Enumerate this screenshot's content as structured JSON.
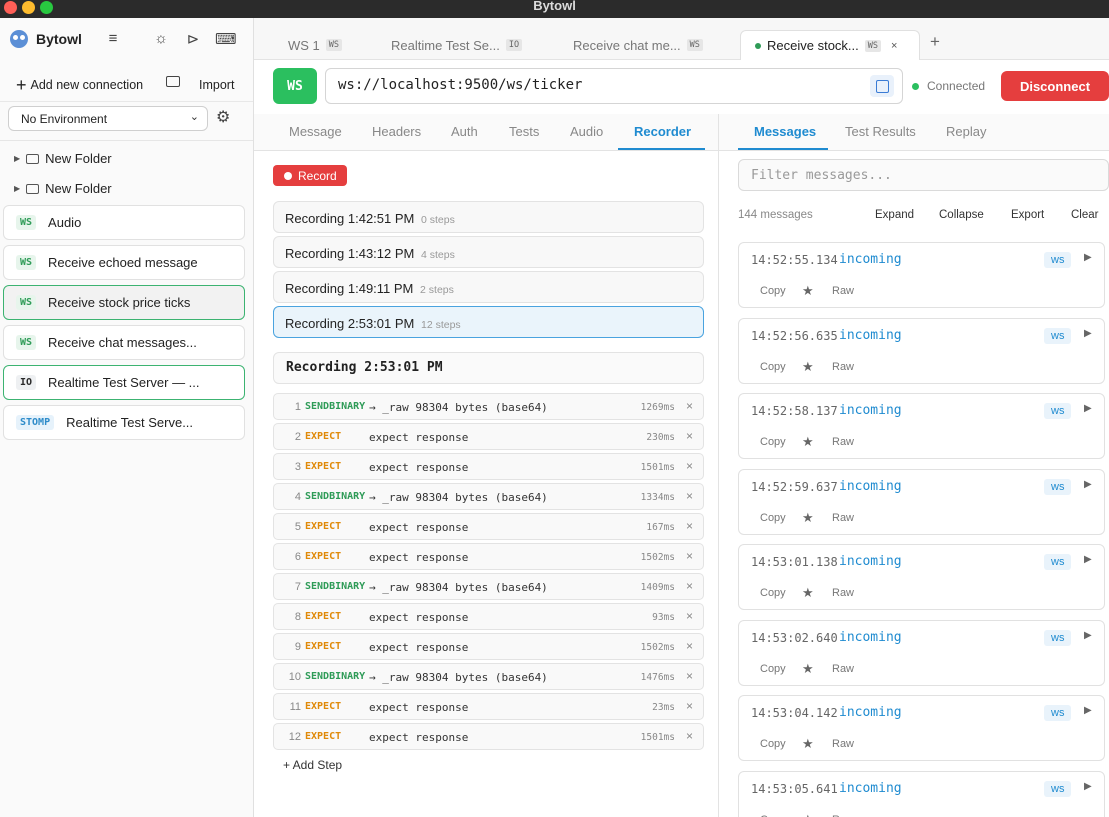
{
  "window": {
    "title": "Bytowl",
    "traffic_lights": [
      "#ff5f57",
      "#febc2e",
      "#28c840"
    ]
  },
  "sidebar": {
    "brand": "Bytowl",
    "add_connection": "Add new connection",
    "import": "Import",
    "environment": "No Environment",
    "folders": [
      "New Folder",
      "New Folder"
    ],
    "connections": [
      {
        "protocol": "WS",
        "name": "Audio"
      },
      {
        "protocol": "WS",
        "name": "Receive echoed message"
      },
      {
        "protocol": "WS",
        "name": "Receive stock price ticks"
      },
      {
        "protocol": "WS",
        "name": "Receive chat messages..."
      },
      {
        "protocol": "IO",
        "name": "Realtime Test Server — ..."
      },
      {
        "protocol": "STOMP",
        "name": "Realtime Test Serve..."
      }
    ]
  },
  "tabs": [
    {
      "label": "WS 1",
      "badge": "WS"
    },
    {
      "label": "Realtime Test Se...",
      "badge": "IO"
    },
    {
      "label": "Receive chat me...",
      "badge": "WS"
    },
    {
      "label": "Receive stock...",
      "badge": "WS",
      "close": "×"
    }
  ],
  "tab_add": "+",
  "request": {
    "protocol": "WS",
    "url": "ws://localhost:9500/ws/ticker",
    "status": "Connected",
    "disconnect": "Disconnect"
  },
  "left_tabs": [
    "Message",
    "Headers",
    "Auth",
    "Tests",
    "Audio",
    "Recorder"
  ],
  "recorder": {
    "record_button": "Record",
    "recordings": [
      {
        "name": "Recording 1:42:51 PM",
        "steps": "0 steps"
      },
      {
        "name": "Recording 1:43:12 PM",
        "steps": "4 steps"
      },
      {
        "name": "Recording 1:49:11 PM",
        "steps": "2 steps"
      },
      {
        "name": "Recording 2:53:01 PM",
        "steps": "12 steps"
      }
    ],
    "detail_title": "Recording 2:53:01 PM",
    "steps": [
      {
        "num": "1",
        "kind": "SENDBINARY",
        "desc": "→ _raw 98304 bytes (base64)",
        "ms": "1269ms"
      },
      {
        "num": "2",
        "kind": "EXPECT",
        "desc": "expect response",
        "ms": "230ms"
      },
      {
        "num": "3",
        "kind": "EXPECT",
        "desc": "expect response",
        "ms": "1501ms"
      },
      {
        "num": "4",
        "kind": "SENDBINARY",
        "desc": "→ _raw 98304 bytes (base64)",
        "ms": "1334ms"
      },
      {
        "num": "5",
        "kind": "EXPECT",
        "desc": "expect response",
        "ms": "167ms"
      },
      {
        "num": "6",
        "kind": "EXPECT",
        "desc": "expect response",
        "ms": "1502ms"
      },
      {
        "num": "7",
        "kind": "SENDBINARY",
        "desc": "→ _raw 98304 bytes (base64)",
        "ms": "1409ms"
      },
      {
        "num": "8",
        "kind": "EXPECT",
        "desc": "expect response",
        "ms": "93ms"
      },
      {
        "num": "9",
        "kind": "EXPECT",
        "desc": "expect response",
        "ms": "1502ms"
      },
      {
        "num": "10",
        "kind": "SENDBINARY",
        "desc": "→ _raw 98304 bytes (base64)",
        "ms": "1476ms"
      },
      {
        "num": "11",
        "kind": "EXPECT",
        "desc": "expect response",
        "ms": "23ms"
      },
      {
        "num": "12",
        "kind": "EXPECT",
        "desc": "expect response",
        "ms": "1501ms"
      }
    ],
    "add_step": "+ Add Step"
  },
  "right_tabs": [
    "Messages",
    "Test Results",
    "Replay"
  ],
  "messages_panel": {
    "filter_placeholder": "Filter messages...",
    "count": "144 messages",
    "actions": [
      "Expand",
      "Collapse",
      "Export",
      "Clear"
    ],
    "messages": [
      {
        "time": "14:52:55.134",
        "direction": "incoming",
        "tag": "ws"
      },
      {
        "time": "14:52:56.635",
        "direction": "incoming",
        "tag": "ws"
      },
      {
        "time": "14:52:58.137",
        "direction": "incoming",
        "tag": "ws"
      },
      {
        "time": "14:52:59.637",
        "direction": "incoming",
        "tag": "ws"
      },
      {
        "time": "14:53:01.138",
        "direction": "incoming",
        "tag": "ws"
      },
      {
        "time": "14:53:02.640",
        "direction": "incoming",
        "tag": "ws"
      },
      {
        "time": "14:53:04.142",
        "direction": "incoming",
        "tag": "ws"
      },
      {
        "time": "14:53:05.641",
        "direction": "incoming",
        "tag": "ws"
      }
    ],
    "copy_label": "Copy",
    "raw_label": "Raw"
  }
}
